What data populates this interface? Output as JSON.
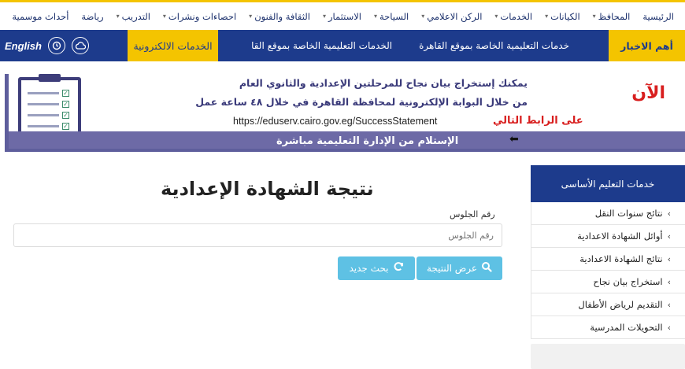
{
  "nav": {
    "items": [
      {
        "label": "الرئيسية",
        "caret": false
      },
      {
        "label": "المحافظ",
        "caret": true
      },
      {
        "label": "الكيانات",
        "caret": true
      },
      {
        "label": "الخدمات",
        "caret": true
      },
      {
        "label": "الركن الاعلامي",
        "caret": true
      },
      {
        "label": "السياحة",
        "caret": true
      },
      {
        "label": "الاستثمار",
        "caret": true
      },
      {
        "label": "الثقافة والفنون",
        "caret": true
      },
      {
        "label": "احصاءات ونشرات",
        "caret": true
      },
      {
        "label": "التدريب",
        "caret": true
      },
      {
        "label": "رياضة",
        "caret": false
      },
      {
        "label": "أحداث موسمية",
        "caret": false
      }
    ]
  },
  "newsbar": {
    "label": "أهم الاخبار",
    "ticker": [
      "خدمات التعليمية الخاصة بموقع القاهرة",
      "الخدمات التعليمية الخاصة بموقع القا"
    ],
    "eservices": "الخدمات الالكترونية",
    "language": "English"
  },
  "banner": {
    "line1": "يمكنك إستخراج بيان نجاح للمرحلتين الإعدادية والثانوي العام",
    "line2": "من خلال البوابة الإلكترونية لمحافظة القاهرة في خلال ٤٨ ساعة عمل",
    "link_label": "على الرابط التالي",
    "url": "https://eduserv.cairo.gov.eg/SuccessStatement",
    "now": "الآن",
    "strip": "الإستلام من الإدارة التعليمية مباشرة"
  },
  "form": {
    "title": "نتيجة الشهادة الإعدادية",
    "label": "رقم الجلوس",
    "placeholder": "رقم الجلوس",
    "result_button": "عرض النتيجة",
    "new_button": "بحث جديد"
  },
  "sidebar": {
    "title": "خدمات التعليم الأساسى",
    "items": [
      "نتائج سنوات النقل",
      "أوائل الشهادة الاعدادية",
      "نتائج الشهادة الاعدادية",
      "استخراج بيان نجاح",
      "التقديم لرياض الأطفال",
      "التحويلات المدرسية"
    ]
  },
  "colors": {
    "primary_blue": "#1d3b8c",
    "accent_yellow": "#f4c400",
    "button_cyan": "#5ec1e4",
    "banner_purple": "#6d6aa6",
    "banner_red": "#d81e1e"
  }
}
